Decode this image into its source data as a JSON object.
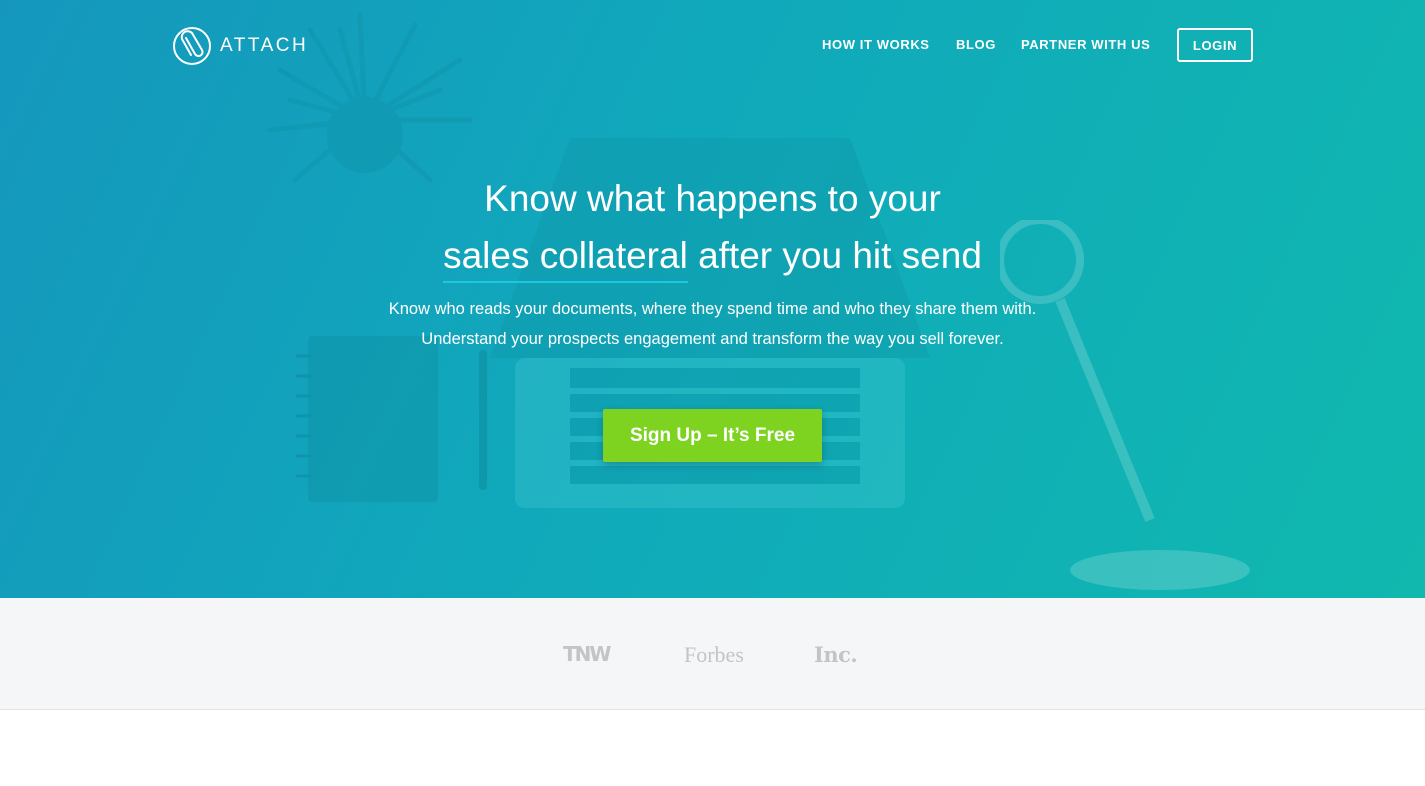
{
  "brand": {
    "name": "ATTACH",
    "icon": "paperclip-circle-icon"
  },
  "nav": {
    "how_it_works": "HOW IT WORKS",
    "blog": "BLOG",
    "partner": "PARTNER WITH US",
    "login": "LOGIN"
  },
  "hero": {
    "headline_line1": "Know what happens to your",
    "headline_underlined": "sales collateral",
    "headline_line2_rest": " after you hit send",
    "subtext_line1": "Know who reads your documents, where they spend time and who they share them with.",
    "subtext_line2": "Understand your prospects engagement and transform the way you sell forever.",
    "cta": "Sign Up – It’s Free"
  },
  "press": [
    "TNW",
    "Forbes",
    "Inc."
  ],
  "colors": {
    "hero_gradient_start": "#1597bd",
    "hero_gradient_end": "#10b8ae",
    "cta_green": "#7ed321",
    "underline_accent": "#1fc7de",
    "press_logo_gray": "#c2c4c6"
  }
}
